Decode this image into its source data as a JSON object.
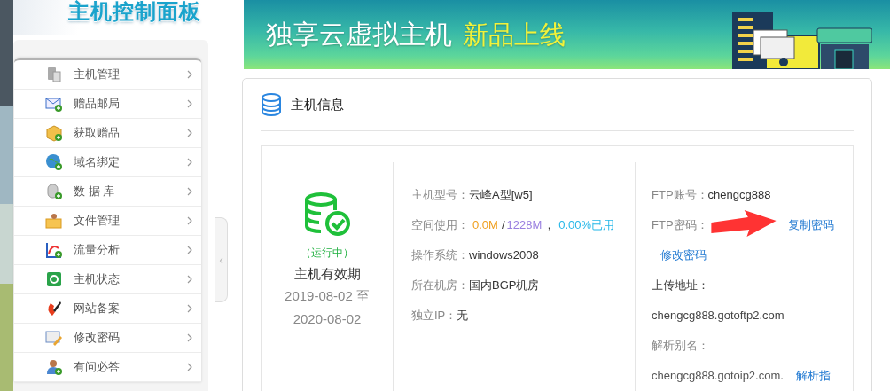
{
  "header": {
    "logo": "主机控制面板"
  },
  "sidebar": {
    "items": [
      {
        "label": "主机管理"
      },
      {
        "label": "赠品邮局"
      },
      {
        "label": "获取赠品"
      },
      {
        "label": "域名绑定"
      },
      {
        "label": "数 据 库"
      },
      {
        "label": "文件管理"
      },
      {
        "label": "流量分析"
      },
      {
        "label": "主机状态"
      },
      {
        "label": "网站备案"
      },
      {
        "label": "修改密码"
      },
      {
        "label": "有问必答"
      }
    ],
    "collapse": "‹"
  },
  "banner": {
    "title": "独享云虚拟主机",
    "highlight": "新品上线"
  },
  "card": {
    "title": "主机信息",
    "status": "（运行中）",
    "validity_label": "主机有效期",
    "validity": "2019-08-02 至 2020-08-02",
    "details": [
      {
        "kind": "text",
        "label": "主机型号：",
        "value": "云峰A型[w5]"
      },
      {
        "kind": "usage",
        "label": "空间使用：",
        "used": "0.0M",
        "slash": "/",
        "total": "1228M",
        "comma": "，",
        "percent": "0.00%已用"
      },
      {
        "kind": "text",
        "label": "操作系统：",
        "value": "windows2008"
      },
      {
        "kind": "text",
        "label": "所在机房：",
        "value": "国内BGP机房"
      },
      {
        "kind": "text",
        "label": "独立IP：",
        "value": "无"
      }
    ],
    "ftp": {
      "account_label": "FTP账号：",
      "account": "chengcg888",
      "password_label": "FTP密码：",
      "copy_link": "复制密码",
      "change_link": "修改密码",
      "upload": "上传地址：chengcg888.gotoftp2.com",
      "alias_label": "解析别名：",
      "alias": "chengcg888.gotoip2.com.",
      "guide_link": "解析指"
    }
  }
}
